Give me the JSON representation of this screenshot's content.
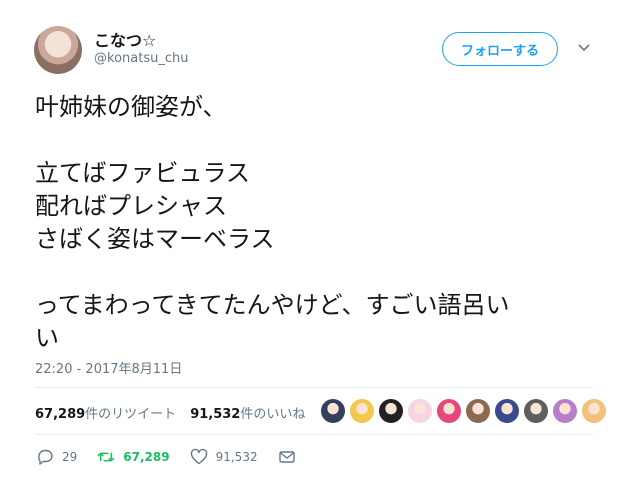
{
  "user": {
    "name": "こなつ☆",
    "handle": "@konatsu_chu"
  },
  "follow_label": "フォローする",
  "tweet_text": "叶姉妹の御姿が、\n\n立てばファビュラス\n配ればプレシャス\nさばく姿はマーベラス\n\nってまわってきてたんやけど、すごい語呂い\nい",
  "timestamp": "22:20 - 2017年8月11日",
  "stats": {
    "retweets_count": "67,289",
    "retweets_label": "件のリツイート",
    "likes_count": "91,532",
    "likes_label": "件のいいね"
  },
  "liker_avatar_colors": [
    "#333f5c",
    "#f2c94c",
    "#222222",
    "#f6d6e4",
    "#e8457a",
    "#8c6a50",
    "#3a4a8a",
    "#5e5e5e",
    "#b77fc8",
    "#f1c27d"
  ],
  "actions": {
    "reply_count": "29",
    "retweet_count": "67,289",
    "like_count": "91,532"
  },
  "colors": {
    "accent": "#1da1f2",
    "retweet": "#17bf63",
    "muted": "#657786"
  }
}
